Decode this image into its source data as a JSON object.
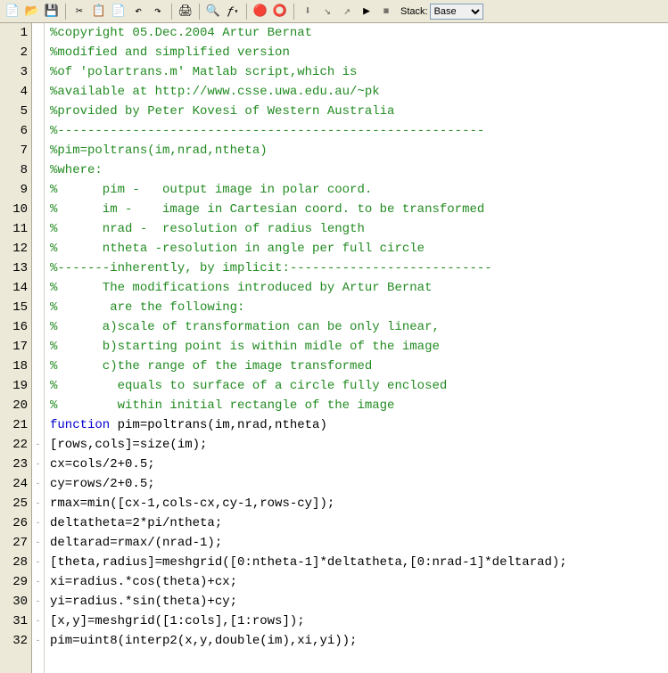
{
  "toolbar": {
    "stack_label": "Stack:",
    "stack_value": "Base"
  },
  "code": {
    "lines": [
      {
        "n": 1,
        "fold": "",
        "tokens": [
          {
            "t": "%copyright 05.Dec.2004 Artur Bernat",
            "c": "comment"
          }
        ]
      },
      {
        "n": 2,
        "fold": "",
        "tokens": [
          {
            "t": "%modified and simplified version",
            "c": "comment"
          }
        ]
      },
      {
        "n": 3,
        "fold": "",
        "tokens": [
          {
            "t": "%of 'polartrans.m' Matlab script,which is",
            "c": "comment"
          }
        ]
      },
      {
        "n": 4,
        "fold": "",
        "tokens": [
          {
            "t": "%available at http://www.csse.uwa.edu.au/~pk",
            "c": "comment"
          }
        ]
      },
      {
        "n": 5,
        "fold": "",
        "tokens": [
          {
            "t": "%provided by Peter Kovesi of Western Australia",
            "c": "comment"
          }
        ]
      },
      {
        "n": 6,
        "fold": "",
        "tokens": [
          {
            "t": "%---------------------------------------------------------",
            "c": "comment"
          }
        ]
      },
      {
        "n": 7,
        "fold": "",
        "tokens": [
          {
            "t": "%pim=poltrans(im,nrad,ntheta)",
            "c": "comment"
          }
        ]
      },
      {
        "n": 8,
        "fold": "",
        "tokens": [
          {
            "t": "%where:",
            "c": "comment"
          }
        ]
      },
      {
        "n": 9,
        "fold": "",
        "tokens": [
          {
            "t": "%      pim -   output image in polar coord.",
            "c": "comment"
          }
        ]
      },
      {
        "n": 10,
        "fold": "",
        "tokens": [
          {
            "t": "%      im -    image in Cartesian coord. to be transformed",
            "c": "comment"
          }
        ]
      },
      {
        "n": 11,
        "fold": "",
        "tokens": [
          {
            "t": "%      nrad -  resolution of radius length",
            "c": "comment"
          }
        ]
      },
      {
        "n": 12,
        "fold": "",
        "tokens": [
          {
            "t": "%      ntheta -resolution in angle per full circle",
            "c": "comment"
          }
        ]
      },
      {
        "n": 13,
        "fold": "",
        "tokens": [
          {
            "t": "%-------inherently, by implicit:---------------------------",
            "c": "comment"
          }
        ]
      },
      {
        "n": 14,
        "fold": "",
        "tokens": [
          {
            "t": "%      The modifications introduced by Artur Bernat",
            "c": "comment"
          }
        ]
      },
      {
        "n": 15,
        "fold": "",
        "tokens": [
          {
            "t": "%       are the following:",
            "c": "comment"
          }
        ]
      },
      {
        "n": 16,
        "fold": "",
        "tokens": [
          {
            "t": "%      a)scale of transformation can be only linear,",
            "c": "comment"
          }
        ]
      },
      {
        "n": 17,
        "fold": "",
        "tokens": [
          {
            "t": "%      b)starting point is within midle of the image",
            "c": "comment"
          }
        ]
      },
      {
        "n": 18,
        "fold": "",
        "tokens": [
          {
            "t": "%      c)the range of the image transformed",
            "c": "comment"
          }
        ]
      },
      {
        "n": 19,
        "fold": "",
        "tokens": [
          {
            "t": "%        equals to surface of a circle fully enclosed",
            "c": "comment"
          }
        ]
      },
      {
        "n": 20,
        "fold": "",
        "tokens": [
          {
            "t": "%        within initial rectangle of the image",
            "c": "comment"
          }
        ]
      },
      {
        "n": 21,
        "fold": "",
        "tokens": [
          {
            "t": "function",
            "c": "keyword"
          },
          {
            "t": " pim=poltrans(im,nrad,ntheta)",
            "c": "normal"
          }
        ]
      },
      {
        "n": 22,
        "fold": "-",
        "tokens": [
          {
            "t": "[rows,cols]=size(im);",
            "c": "normal"
          }
        ]
      },
      {
        "n": 23,
        "fold": "-",
        "tokens": [
          {
            "t": "cx=cols/2+0.5;",
            "c": "normal"
          }
        ]
      },
      {
        "n": 24,
        "fold": "-",
        "tokens": [
          {
            "t": "cy=rows/2+0.5;",
            "c": "normal"
          }
        ]
      },
      {
        "n": 25,
        "fold": "-",
        "tokens": [
          {
            "t": "rmax=min([cx-1,cols-cx,cy-1,rows-cy]);",
            "c": "normal"
          }
        ]
      },
      {
        "n": 26,
        "fold": "-",
        "tokens": [
          {
            "t": "deltatheta=2*pi/ntheta;",
            "c": "normal"
          }
        ]
      },
      {
        "n": 27,
        "fold": "-",
        "tokens": [
          {
            "t": "deltarad=rmax/(nrad-1);",
            "c": "normal"
          }
        ]
      },
      {
        "n": 28,
        "fold": "-",
        "tokens": [
          {
            "t": "[theta,radius]=meshgrid([0:ntheta-1]*deltatheta,[0:nrad-1]*deltarad);",
            "c": "normal"
          }
        ]
      },
      {
        "n": 29,
        "fold": "-",
        "tokens": [
          {
            "t": "xi=radius.*cos(theta)+cx;",
            "c": "normal"
          }
        ]
      },
      {
        "n": 30,
        "fold": "-",
        "tokens": [
          {
            "t": "yi=radius.*sin(theta)+cy;",
            "c": "normal"
          }
        ]
      },
      {
        "n": 31,
        "fold": "-",
        "tokens": [
          {
            "t": "[x,y]=meshgrid([1:cols],[1:rows]);",
            "c": "normal"
          }
        ]
      },
      {
        "n": 32,
        "fold": "-",
        "tokens": [
          {
            "t": "pim=uint8(interp2(x,y,double(im),xi,yi));",
            "c": "normal"
          }
        ]
      }
    ]
  }
}
